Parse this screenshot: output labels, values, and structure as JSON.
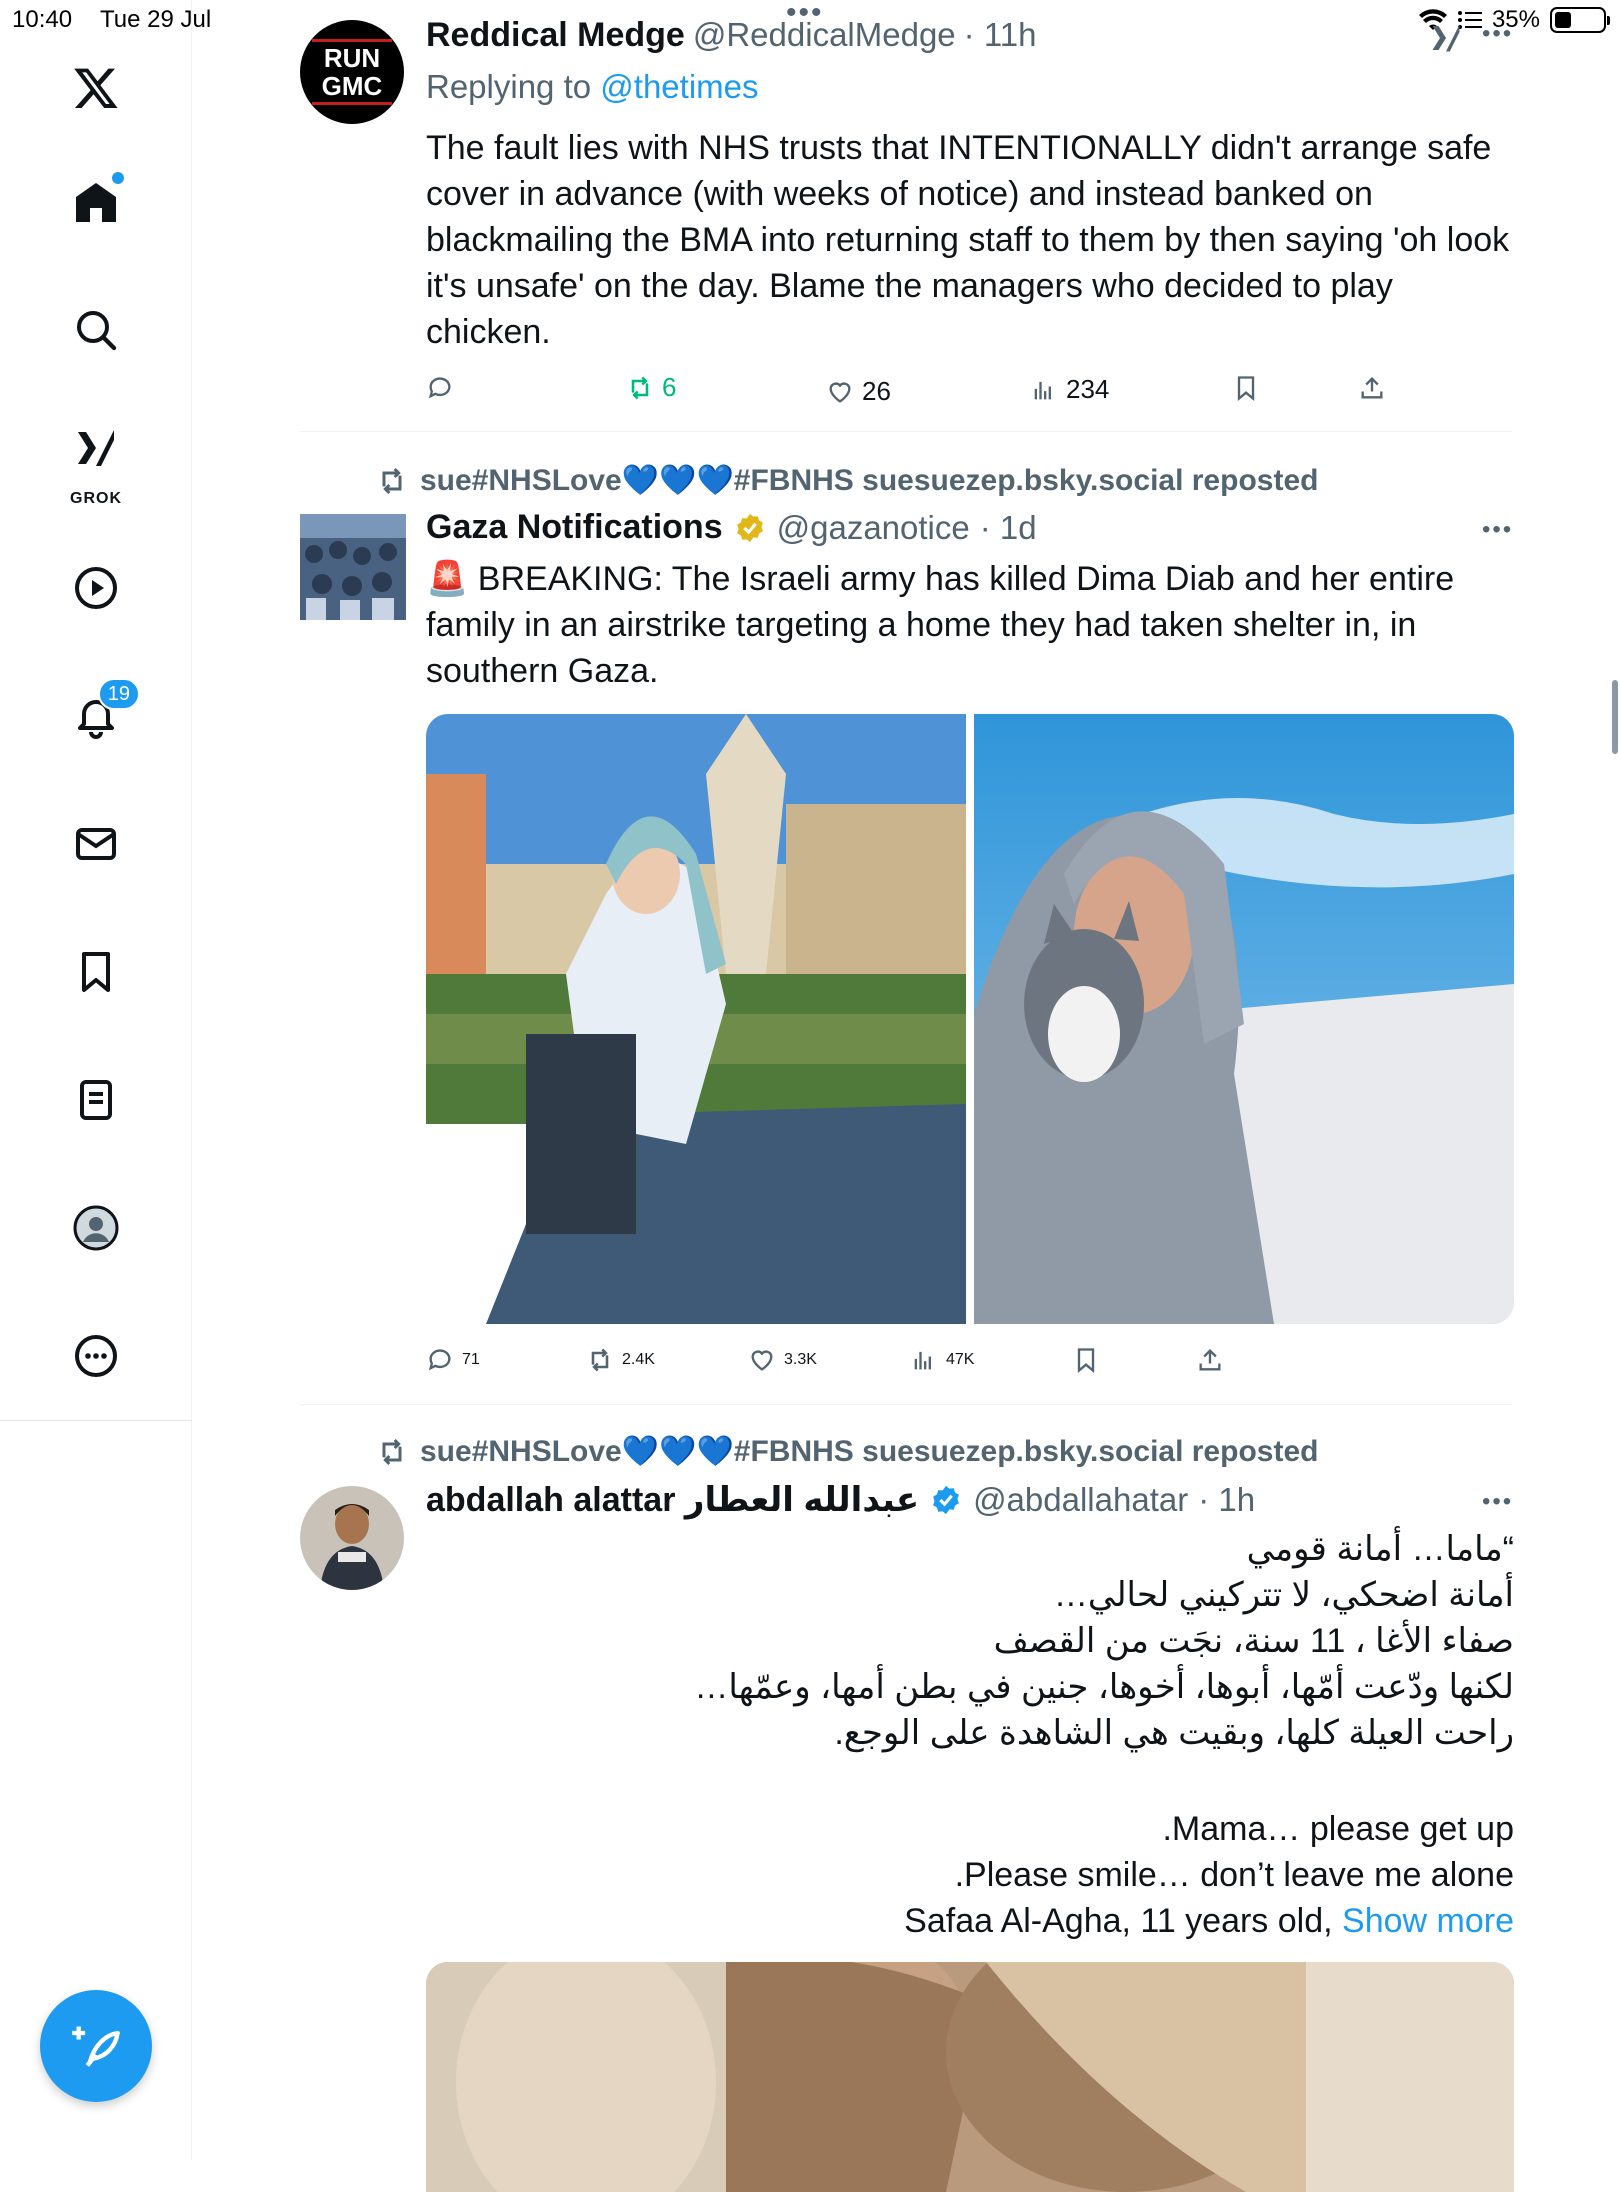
{
  "status_bar": {
    "time": "10:40",
    "date": "Tue 29 Jul",
    "battery": "35%",
    "battery_level": 0.35
  },
  "sidebar": {
    "notification_count": "19",
    "grok_label": "GROK"
  },
  "posts": [
    {
      "avatar_text": "RUN GMC",
      "name": "Reddical Medge",
      "handle": "@ReddicalMedge",
      "time": "· 11h",
      "replying_prefix": "Replying to",
      "replying_handle": "@thetimes",
      "text": "The fault lies with NHS trusts that INTENTIONALLY didn't arrange safe cover in advance (with weeks of notice) and instead banked on blackmailing the BMA into returning staff to them by then saying 'oh look it's unsafe' on the day. Blame the managers who decided to play chicken.",
      "replies": "",
      "reposts": "6",
      "likes": "26",
      "views": "234"
    },
    {
      "repost_line": "sue#NHSLove💙💙💙#FBNHS suesuezep.bsky.social reposted",
      "name": "Gaza Notifications",
      "handle": "@gazanotice",
      "time": "· 1d",
      "text": "🚨 BREAKING: The Israeli army has killed Dima Diab and her entire family in an airstrike targeting a home they had taken shelter in, in southern Gaza.",
      "replies": "71",
      "reposts": "2.4K",
      "likes": "3.3K",
      "views": "47K"
    },
    {
      "repost_line": "sue#NHSLove💙💙💙#FBNHS suesuezep.bsky.social reposted",
      "name": "abdallah alattar عبدالله العطار",
      "handle": "@abdallahatar",
      "time": "· 1h",
      "arabic_lines": [
        "“ماما… أمانة قومي",
        "أمانة اضحكي، لا تتركيني لحالي…",
        "صفاء الأغا ، 11 سنة، نجَت من القصف",
        "لكنها ودّعت أمّها، أبوها، أخوها، جنين في بطن أمها، وعمّها…",
        "راحت العيلة كلها، وبقيت هي الشاهدة على الوجع."
      ],
      "english_lines": [
        ".Mama… please get up",
        ".Please smile… don’t leave me alone",
        "Safaa Al-Agha, 11 years old,"
      ],
      "show_more": "Show more"
    }
  ],
  "colors": {
    "accent": "#1d9bf0",
    "repost_green": "#00ba7c",
    "muted": "#536471"
  }
}
